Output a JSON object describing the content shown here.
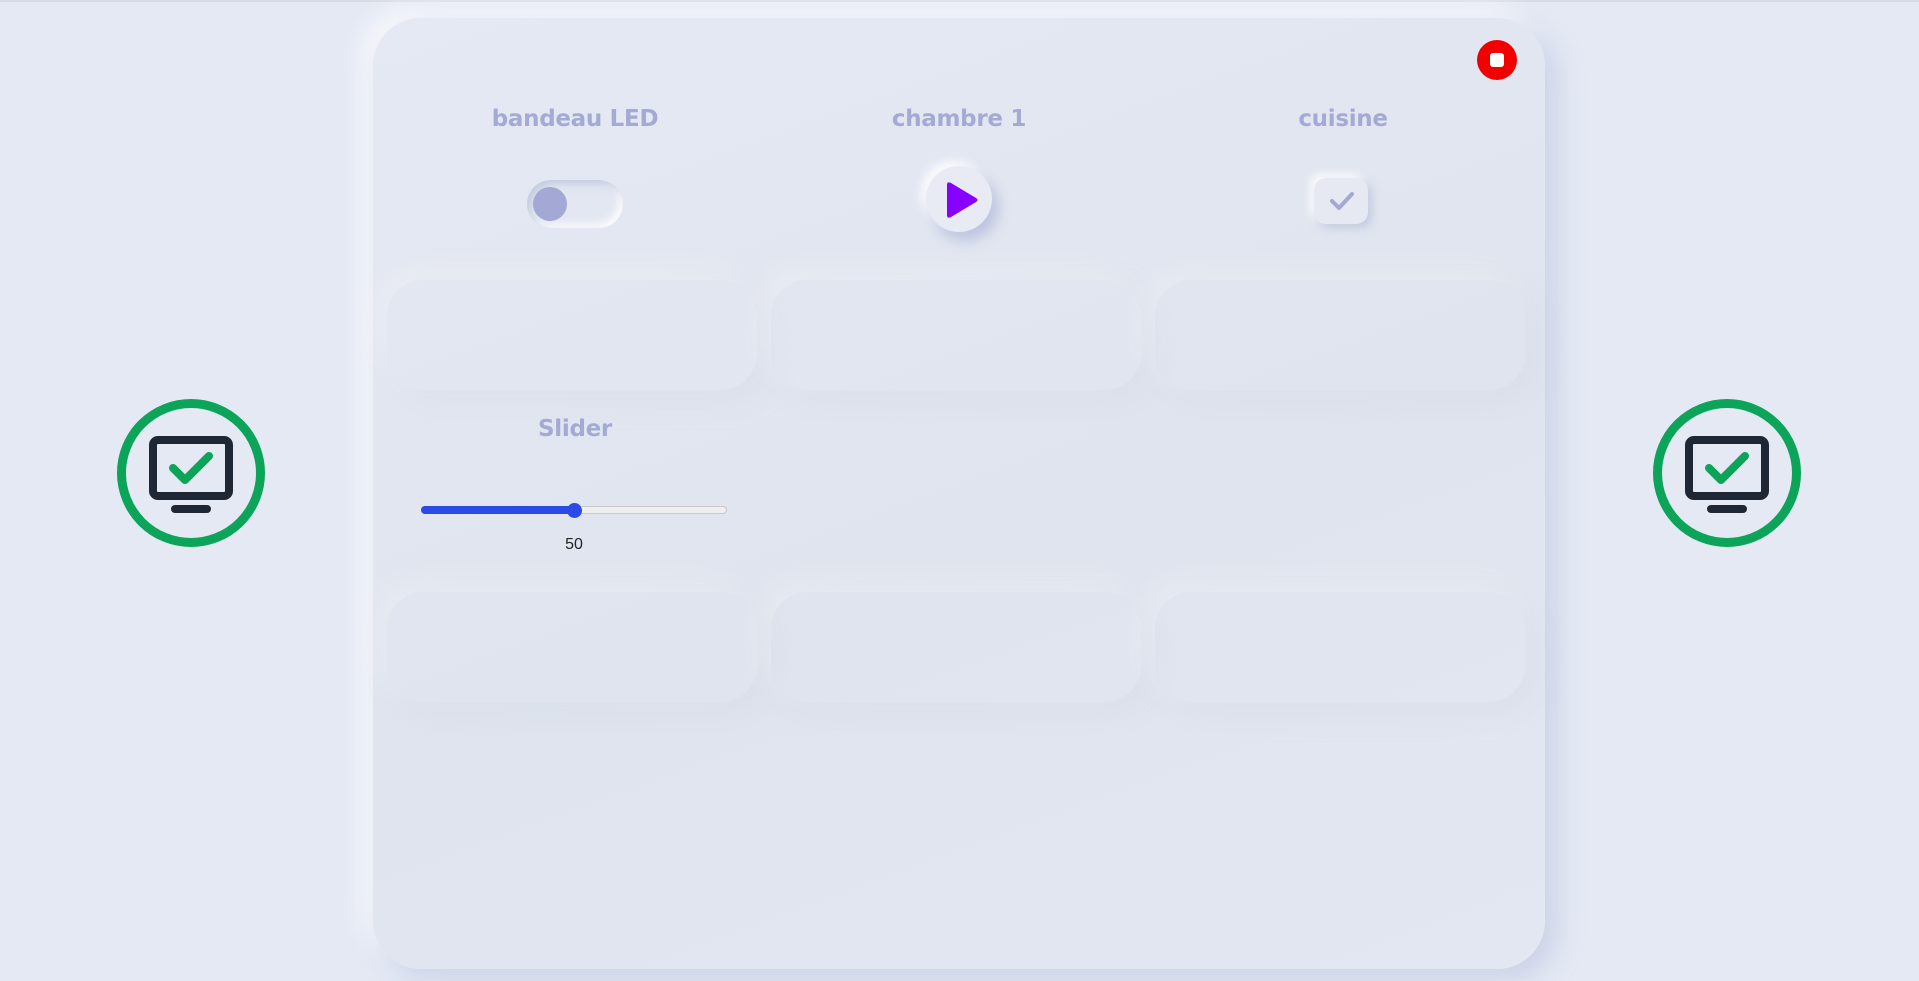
{
  "panel": {
    "widgets": [
      {
        "label": "bandeau LED",
        "type": "toggle",
        "state": "off"
      },
      {
        "label": "chambre 1",
        "type": "play-button",
        "icon": "play-icon"
      },
      {
        "label": "cuisine",
        "type": "checkbox",
        "icon": "check-icon"
      }
    ],
    "slider": {
      "label": "Slider",
      "value": 50,
      "value_text": "50",
      "min": 0,
      "max": 100
    },
    "stop_button": {
      "icon": "stop-icon"
    }
  },
  "status": {
    "icon": "monitor-check-icon"
  },
  "colors": {
    "background": "#e4e9f4",
    "label": "#a3aad4",
    "accent": "#2c4ae6",
    "play": "#8800ff",
    "stop": "#f20000",
    "status_ring": "#0ba458",
    "monitor": "#1e2733"
  }
}
